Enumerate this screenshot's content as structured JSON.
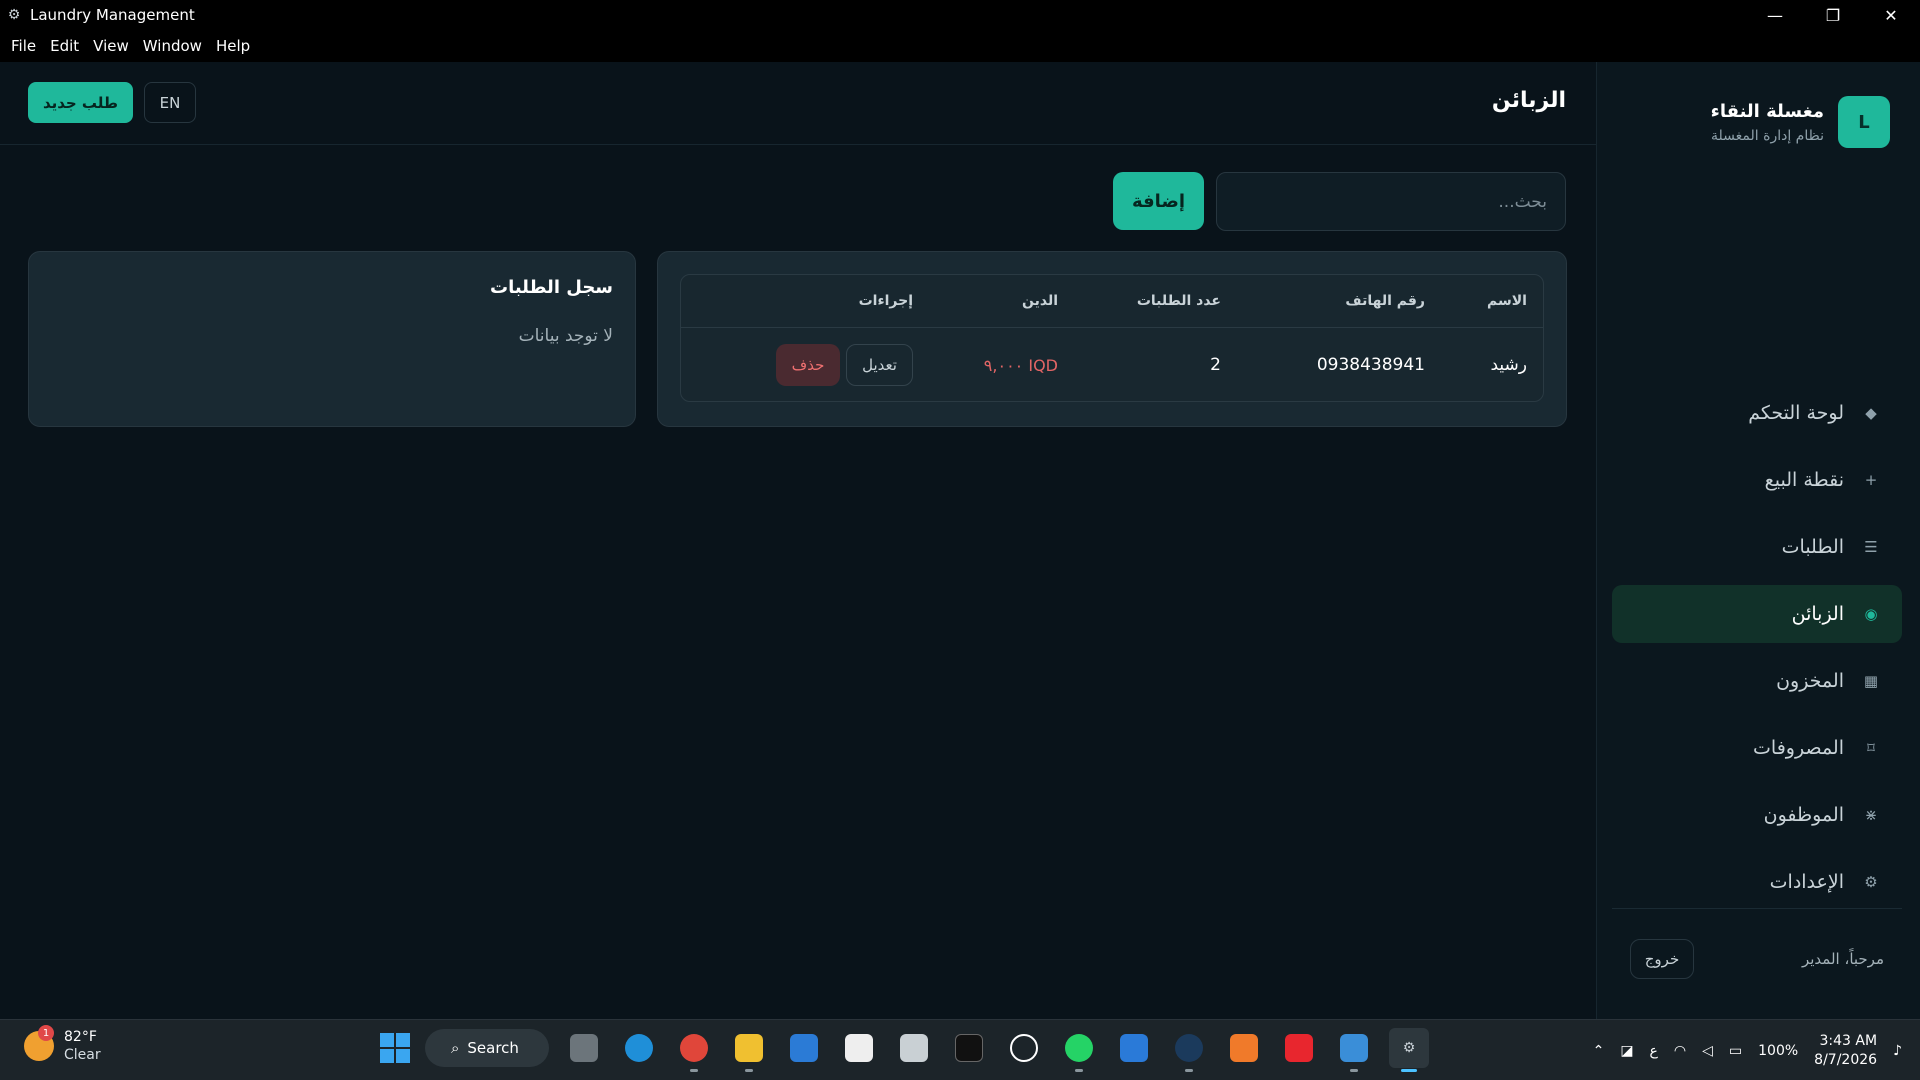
{
  "window": {
    "title": "Laundry Management",
    "controls": {
      "minimize": "—",
      "restore": "❐",
      "close": "✕"
    }
  },
  "menu": [
    "File",
    "Edit",
    "View",
    "Window",
    "Help"
  ],
  "brand": {
    "logo_letter": "L",
    "name": "مغسلة النقاء",
    "subtitle": "نظام إدارة المغسلة"
  },
  "nav": [
    {
      "label": "لوحة التحكم",
      "icon": "◆",
      "icon_name": "diamond-icon",
      "active": false
    },
    {
      "label": "نقطة البيع",
      "icon": "+",
      "icon_name": "plus-icon",
      "active": false
    },
    {
      "label": "الطلبات",
      "icon": "☰",
      "icon_name": "list-icon",
      "active": false
    },
    {
      "label": "الزبائن",
      "icon": "◉",
      "icon_name": "customers-icon",
      "active": true
    },
    {
      "label": "المخزون",
      "icon": "▦",
      "icon_name": "grid-icon",
      "active": false
    },
    {
      "label": "المصروفات",
      "icon": "⌑",
      "icon_name": "expenses-icon",
      "active": false
    },
    {
      "label": "الموظفون",
      "icon": "⋇",
      "icon_name": "employees-icon",
      "active": false
    },
    {
      "label": "الإعدادات",
      "icon": "⚙",
      "icon_name": "gear-icon",
      "active": false
    }
  ],
  "footer": {
    "welcome": "مرحباً، المدير",
    "logout": "خروج"
  },
  "header": {
    "title": "الزبائن",
    "new_order": "طلب جديد",
    "language": "EN"
  },
  "search": {
    "placeholder": "بحث...",
    "value": ""
  },
  "add_button": "إضافة",
  "customers_table": {
    "columns": {
      "name": "الاسم",
      "phone": "رقم الهاتف",
      "orders": "عدد الطلبات",
      "debt": "الدين",
      "actions": "إجراءات"
    },
    "rows": [
      {
        "name": "رشيد",
        "phone": "0938438941",
        "orders": "2",
        "debt": "IQD ٩,٠٠٠",
        "edit": "تعديل",
        "delete": "حذف"
      }
    ]
  },
  "history": {
    "title": "سجل الطلبات",
    "empty": "لا توجد بيانات"
  },
  "taskbar": {
    "weather": {
      "temp": "82°F",
      "condition": "Clear",
      "badge": "1"
    },
    "search": "Search",
    "tray": {
      "ime": "ع",
      "battery": "100%",
      "time": "3:43 AM",
      "date": "8/7/2026"
    }
  },
  "colors": {
    "accent": "#1fb89b",
    "danger": "#e26565",
    "background": "#09131a",
    "panel": "#192932"
  }
}
